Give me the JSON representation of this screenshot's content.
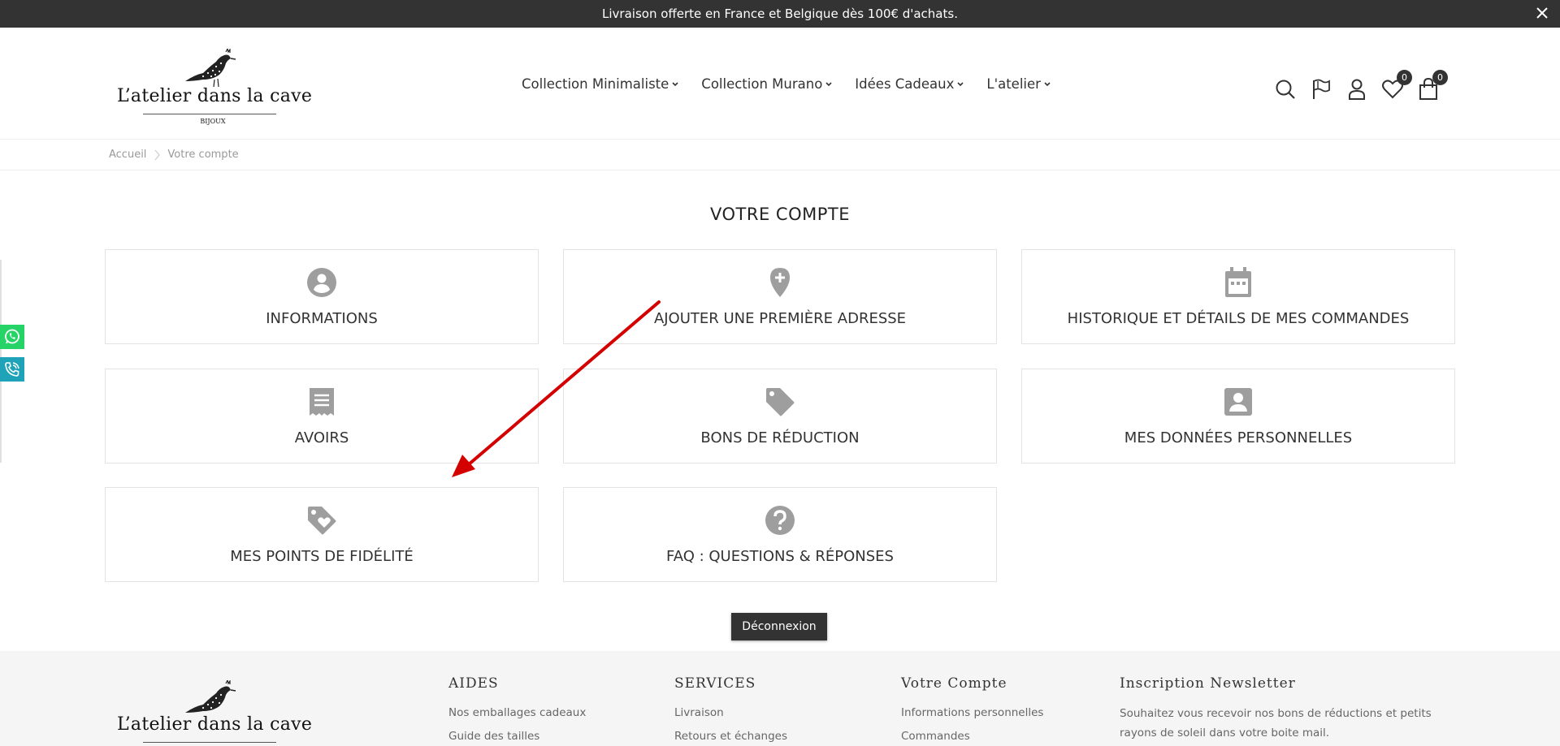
{
  "announcement": {
    "text": "Livraison offerte en France et Belgique dès 100€ d'achats."
  },
  "brand": {
    "name": "L’atelier dans la cave",
    "subtitle": "BIJOUX"
  },
  "nav": [
    {
      "label": "Collection Minimaliste"
    },
    {
      "label": "Collection Murano"
    },
    {
      "label": "Idées Cadeaux"
    },
    {
      "label": "L'atelier"
    }
  ],
  "header_icons": {
    "wishlist_count": "0",
    "cart_count": "0"
  },
  "breadcrumb": {
    "home": "Accueil",
    "current": "Votre compte"
  },
  "page": {
    "title": "VOTRE COMPTE"
  },
  "cards": [
    {
      "label": "INFORMATIONS",
      "icon": "account-circle-icon"
    },
    {
      "label": "AJOUTER UNE PREMIÈRE ADRESSE",
      "icon": "add-location-icon"
    },
    {
      "label": "HISTORIQUE ET DÉTAILS DE MES COMMANDES",
      "icon": "calendar-icon"
    },
    {
      "label": "AVOIRS",
      "icon": "receipt-icon"
    },
    {
      "label": "BONS DE RÉDUCTION",
      "icon": "tag-icon"
    },
    {
      "label": "MES DONNÉES PERSONNELLES",
      "icon": "account-box-icon"
    },
    {
      "label": "MES POINTS DE FIDÉLITÉ",
      "icon": "loyalty-icon"
    },
    {
      "label": "FAQ : QUESTIONS & RÉPONSES",
      "icon": "help-icon"
    }
  ],
  "logout": {
    "label": "Déconnexion"
  },
  "footer": {
    "aides": {
      "title": "AIDES",
      "links": [
        "Nos emballages cadeaux",
        "Guide des tailles"
      ]
    },
    "services": {
      "title": "SERVICES",
      "links": [
        "Livraison",
        "Retours et échanges"
      ]
    },
    "account": {
      "title": "Votre Compte",
      "links": [
        "Informations personnelles",
        "Commandes"
      ]
    },
    "newsletter": {
      "title": "Inscription Newsletter",
      "text": "Souhaitez vous recevoir nos bons de réductions et petits rayons de soleil dans votre boite mail."
    }
  },
  "colors": {
    "dark": "#333333",
    "icon_grey": "#9e9e9e",
    "whatsapp": "#25d366",
    "phone": "#1fa3b8",
    "annotation_arrow": "#d40000"
  }
}
